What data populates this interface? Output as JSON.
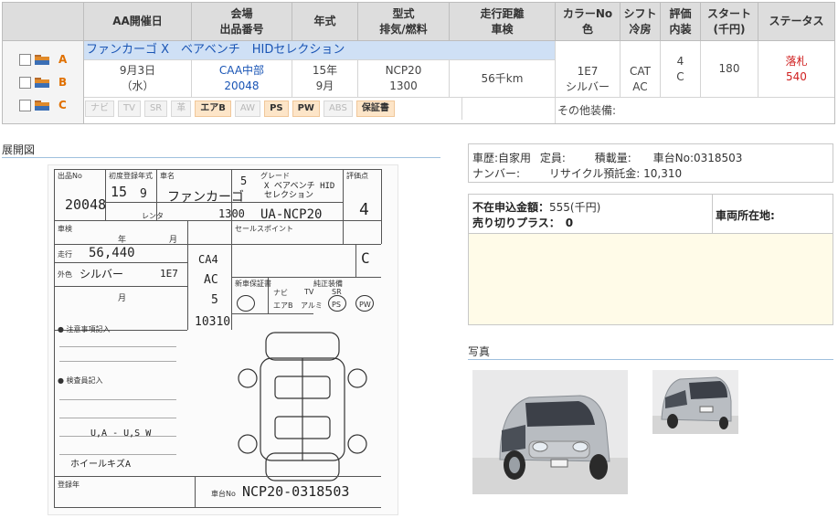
{
  "table": {
    "headers": [
      {
        "l1": "AA開催日",
        "l2": ""
      },
      {
        "l1": "会場",
        "l2": "出品番号"
      },
      {
        "l1": "年式",
        "l2": ""
      },
      {
        "l1": "型式",
        "l2": "排気/燃料"
      },
      {
        "l1": "走行距離",
        "l2": "車検"
      },
      {
        "l1": "カラーNo",
        "l2": "色"
      },
      {
        "l1": "シフト",
        "l2": "冷房"
      },
      {
        "l1": "評価",
        "l2": "内装"
      },
      {
        "l1": "スタート",
        "l2": "(千円)"
      },
      {
        "l1": "ステータス",
        "l2": ""
      }
    ],
    "model": "ファンカーゴ X　ベアベンチ　HIDセレクション",
    "grades": [
      "A",
      "B",
      "C"
    ],
    "row": {
      "date": "9月3日",
      "weekday": "（水）",
      "venue": "CAA中部",
      "lot": "20048",
      "year": "15年",
      "month": "9月",
      "model_code": "NCP20",
      "displacement": "1300",
      "mileage": "56千km",
      "color_no": "1E7",
      "color": "シルバー",
      "shift": "CAT",
      "ac": "AC",
      "score": "4",
      "interior": "C",
      "start_price": "180",
      "status": "落札",
      "sold_price": "540"
    },
    "options": [
      {
        "label": "ナビ",
        "on": false
      },
      {
        "label": "TV",
        "on": false
      },
      {
        "label": "SR",
        "on": false
      },
      {
        "label": "革",
        "on": false
      },
      {
        "label": "エアB",
        "on": true
      },
      {
        "label": "AW",
        "on": false
      },
      {
        "label": "PS",
        "on": true
      },
      {
        "label": "PW",
        "on": true
      },
      {
        "label": "ABS",
        "on": false
      },
      {
        "label": "保証書",
        "on": true
      }
    ],
    "other_equipment_label": "その他装備:"
  },
  "sheet_section_title": "展開図",
  "sheet": {
    "lot": "20048",
    "year_hw": "15",
    "month_hw": "9",
    "name_hw": "ファンカーゴ",
    "door_hw": "5",
    "grade_hw": "X ベアベンチ HIDセレクション",
    "model_hw": "UA-NCP20",
    "disp_hw": "1300",
    "score_hw": "4",
    "interior_hw": "C",
    "mileage_hw": "56,440",
    "color_hw": "シルバー",
    "color_no_hw": "1E7",
    "shift_hw": "CA4",
    "ac_hw": "AC",
    "seats_hw": "5",
    "recycle_hw": "10310",
    "note1_hw": "U,A - U,S W",
    "note2_hw": "ホイールキズA",
    "chassis_hw": "NCP20-0318503",
    "labels": {
      "lot": "出品No",
      "first_reg": "初度登録年式",
      "name": "車名",
      "grade": "グレード",
      "score": "評価点",
      "rental": "レンタ",
      "inspection": "車検",
      "mileage": "走行",
      "color": "外色",
      "sale_point": "セールスポイント",
      "new_car_warranty": "新車保証書",
      "equipment": "純正装備",
      "notes": "● 注意事項記入",
      "inspector_notes": "● 検査員記入",
      "chassis": "車台No",
      "registered": "登録年",
      "year_unit": "年",
      "month_unit": "月",
      "navi": "ナビ",
      "tv": "TV",
      "sr": "SR",
      "airbag": "エアB",
      "alloy": "アルミ",
      "ps": "PS",
      "pw": "PW"
    }
  },
  "info": {
    "history": "車歴:自家用",
    "capacity_label": "定員:",
    "load_label": "積載量:",
    "chassis": "車台No:0318503",
    "number_label": "ナンバー:",
    "recycle": "リサイクル預託金: 10,310"
  },
  "bids": {
    "absent_bid_label": "不在申込金額：",
    "absent_bid_value": "555(千円)",
    "sell_plus_label": "売り切りプラス：",
    "sell_plus_value": "0",
    "location_label": "車両所在地:"
  },
  "photos_title": "写真",
  "colors": {
    "header_bg": "#dddddd",
    "model_bar": "#cfe0f5",
    "link_blue": "#1a55b5",
    "sold_red": "#d02020",
    "grade_orange": "#e07000",
    "panel_bg": "#fffbe8"
  }
}
